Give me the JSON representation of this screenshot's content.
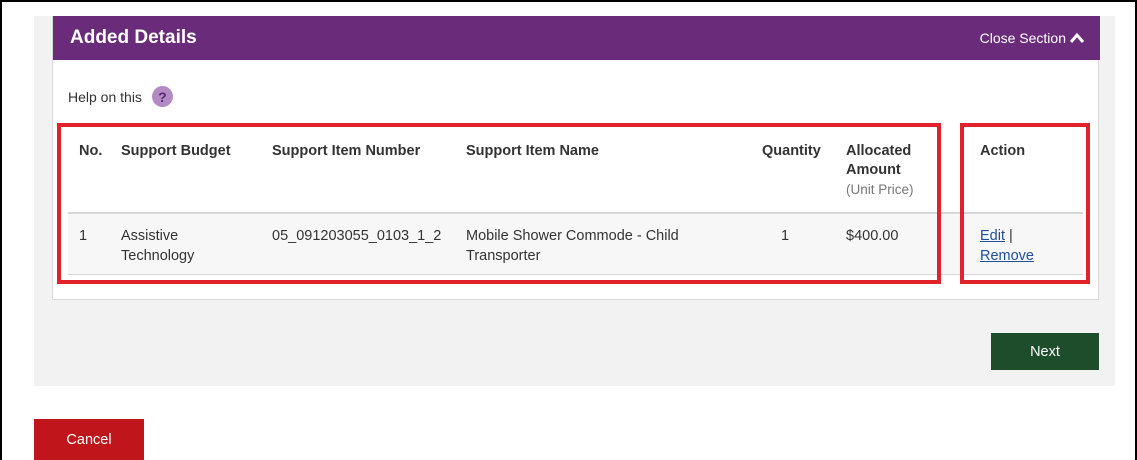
{
  "section": {
    "title": "Added Details",
    "close_label": "Close Section"
  },
  "help": {
    "label": "Help on this",
    "icon_glyph": "?"
  },
  "table": {
    "headers": {
      "no": "No.",
      "support_budget": "Support Budget",
      "support_item_number": "Support Item Number",
      "support_item_name": "Support Item Name",
      "quantity": "Quantity",
      "allocated_line1": "Allocated",
      "allocated_line2": "Amount",
      "allocated_sub": "(Unit Price)",
      "action": "Action"
    },
    "rows": [
      {
        "no": "1",
        "support_budget_line1": "Assistive",
        "support_budget_line2": "Technology",
        "support_item_number": "05_091203055_0103_1_2",
        "support_item_name_line1": "Mobile Shower Commode - Child",
        "support_item_name_line2": "Transporter",
        "quantity": "1",
        "allocated_amount": "$400.00",
        "edit_label": "Edit",
        "separator": "|",
        "remove_label": "Remove"
      }
    ]
  },
  "buttons": {
    "next": "Next",
    "cancel": "Cancel"
  },
  "colors": {
    "header_purple": "#6a2c7a",
    "next_green": "#1e4d2b",
    "cancel_red": "#c0151b",
    "highlight_red": "#e0232b",
    "link_blue": "#1f4e9a"
  }
}
